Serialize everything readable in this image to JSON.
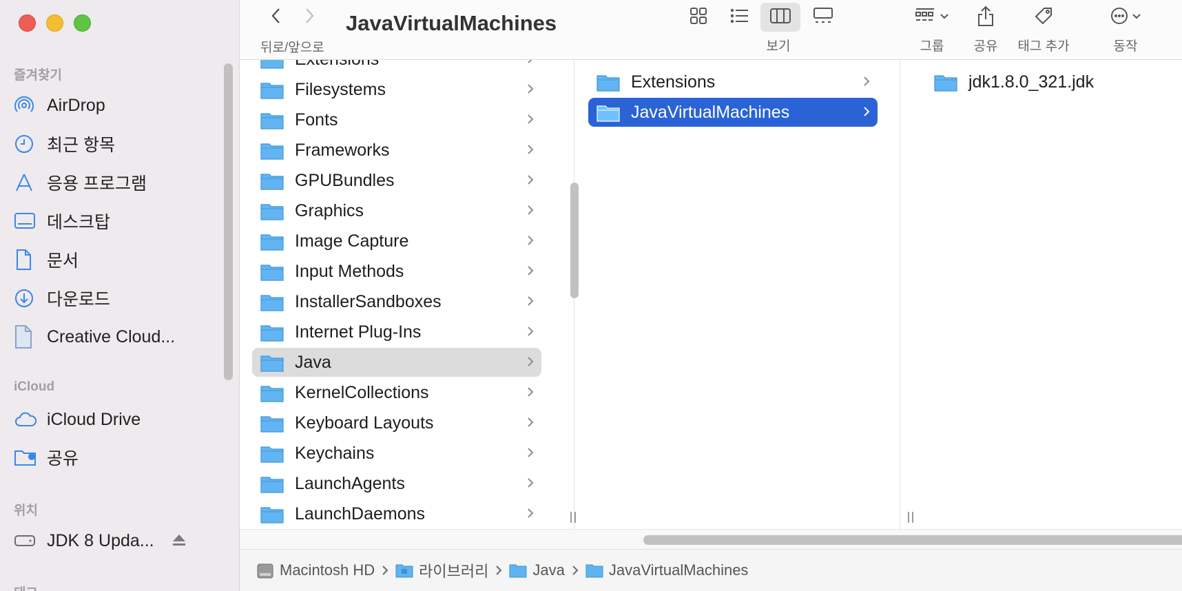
{
  "window": {
    "title": "JavaVirtualMachines"
  },
  "toolbar": {
    "back_label": "뒤로/앞으로",
    "view_label": "보기",
    "group_label": "그룹",
    "share_label": "공유",
    "tag_label": "태그 추가",
    "action_label": "동작",
    "view_modes": [
      "icon-view-icon",
      "list-view-icon",
      "column-view-icon",
      "gallery-view-icon"
    ],
    "active_view": "column"
  },
  "sidebar": {
    "favorites_header": "즐겨찾기",
    "favorites": [
      {
        "label": "AirDrop",
        "icon": "airdrop-icon"
      },
      {
        "label": "최근 항목",
        "icon": "clock-icon"
      },
      {
        "label": "응용 프로그램",
        "icon": "applications-icon"
      },
      {
        "label": "데스크탑",
        "icon": "desktop-icon"
      },
      {
        "label": "문서",
        "icon": "document-icon"
      },
      {
        "label": "다운로드",
        "icon": "download-icon"
      },
      {
        "label": "Creative Cloud...",
        "icon": "file-icon"
      }
    ],
    "icloud_header": "iCloud",
    "icloud": [
      {
        "label": "iCloud Drive",
        "icon": "cloud-icon"
      },
      {
        "label": "공유",
        "icon": "shared-folder-icon"
      }
    ],
    "locations_header": "위치",
    "locations": [
      {
        "label": "JDK 8 Upda...",
        "icon": "disk-icon"
      }
    ],
    "tags_header": "태그"
  },
  "columns": {
    "col1": [
      "Extensions",
      "Filesystems",
      "Fonts",
      "Frameworks",
      "GPUBundles",
      "Graphics",
      "Image Capture",
      "Input Methods",
      "InstallerSandboxes",
      "Internet Plug-Ins",
      "Java",
      "KernelCollections",
      "Keyboard Layouts",
      "Keychains",
      "LaunchAgents",
      "LaunchDaemons"
    ],
    "col1_selected": "Java",
    "col2": [
      "Extensions",
      "JavaVirtualMachines"
    ],
    "col2_selected": "JavaVirtualMachines",
    "col3": [
      "jdk1.8.0_321.jdk"
    ]
  },
  "pathbar": [
    "Macintosh HD",
    "라이브러리",
    "Java",
    "JavaVirtualMachines"
  ],
  "colors": {
    "accent": "#2a63d6",
    "folder": "#5fb3f0",
    "sidebar_icon": "#3a86e8"
  }
}
